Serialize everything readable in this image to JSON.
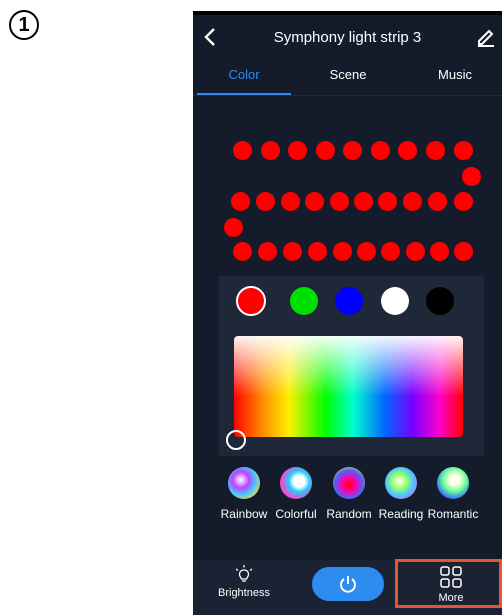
{
  "step_badge": "1",
  "header": {
    "title": "Symphony light strip 3"
  },
  "tabs": [
    {
      "label": "Color",
      "active": true
    },
    {
      "label": "Scene",
      "active": false
    },
    {
      "label": "Music",
      "active": false
    }
  ],
  "led_color": "#ff0000",
  "swatches": [
    {
      "name": "red",
      "color": "#ff0000",
      "selected": true
    },
    {
      "name": "green",
      "color": "#00e000"
    },
    {
      "name": "blue",
      "color": "#0000ff"
    },
    {
      "name": "white",
      "color": "#ffffff"
    },
    {
      "name": "black",
      "color": "#000000"
    }
  ],
  "effects": [
    {
      "label": "Rainbow"
    },
    {
      "label": "Colorful"
    },
    {
      "label": "Random"
    },
    {
      "label": "Reading"
    },
    {
      "label": "Romantic"
    }
  ],
  "bottom_bar": {
    "brightness_label": "Brightness",
    "more_label": "More"
  },
  "colors": {
    "accent": "#2f8bf0",
    "highlight": "#e0582b"
  }
}
